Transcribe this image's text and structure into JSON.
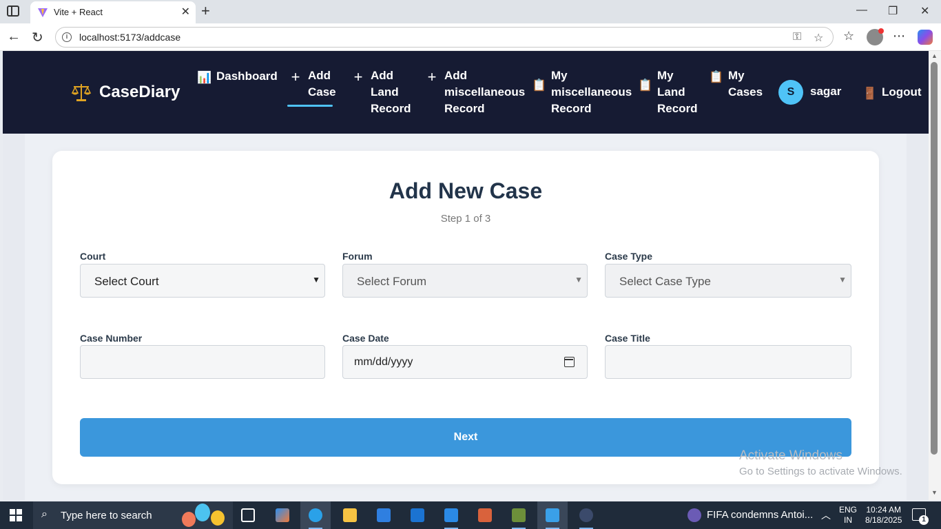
{
  "browser": {
    "tab_title": "Vite + React",
    "url": "localhost:5173/addcase"
  },
  "app": {
    "brand": "CaseDiary",
    "nav": [
      {
        "icon": "bar-chart-icon",
        "lines": [
          "Dashboard"
        ]
      },
      {
        "icon": "plus-icon",
        "lines": [
          "Add",
          "Case"
        ]
      },
      {
        "icon": "plus-icon",
        "lines": [
          "Add",
          "Land",
          "Record"
        ]
      },
      {
        "icon": "plus-icon",
        "lines": [
          "Add",
          "miscellaneous",
          "Record"
        ]
      },
      {
        "icon": "clipboard-icon",
        "lines": [
          "My",
          "miscellaneous",
          "Record"
        ]
      },
      {
        "icon": "clipboard-icon",
        "lines": [
          "My",
          "Land",
          "Record"
        ]
      },
      {
        "icon": "clipboard-icon",
        "lines": [
          "My",
          "Cases"
        ]
      }
    ],
    "user": {
      "initial": "S",
      "name": "sagar"
    },
    "logout": "Logout"
  },
  "form": {
    "title": "Add New Case",
    "step": "Step 1 of 3",
    "court_label": "Court",
    "court_value": "Select Court",
    "forum_label": "Forum",
    "forum_value": "Select Forum",
    "case_type_label": "Case Type",
    "case_type_value": "Select Case Type",
    "case_number_label": "Case Number",
    "case_number_value": "",
    "case_date_label": "Case Date",
    "case_date_value": "mm/dd/yyyy",
    "case_title_label": "Case Title",
    "case_title_value": "",
    "next_label": "Next"
  },
  "watermark": {
    "line1": "Activate Windows",
    "line2": "Go to Settings to activate Windows."
  },
  "taskbar": {
    "search_placeholder": "Type here to search",
    "news": "FIFA condemns Antoi...",
    "lang_1": "ENG",
    "lang_2": "IN",
    "time": "10:24 AM",
    "date": "8/18/2025",
    "notification_count": "1"
  },
  "colors": {
    "navbar": "#161b33",
    "accent": "#4fc3f7",
    "button": "#3b97dc",
    "title": "#22344a"
  }
}
